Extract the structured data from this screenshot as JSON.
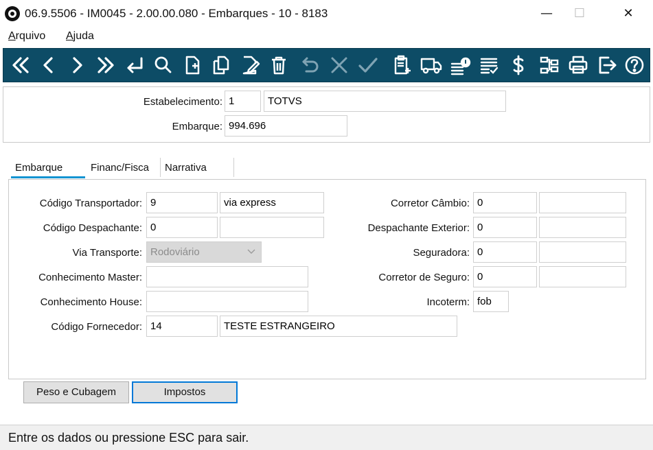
{
  "window": {
    "title": "06.9.5506 - IM0045 - 2.00.00.080 - Embarques - 10 - 8183",
    "minimize": "—",
    "maximize": "☐",
    "close": "✕"
  },
  "menu": {
    "items": [
      {
        "label": "Arquivo",
        "accel": "A"
      },
      {
        "label": "Ajuda",
        "accel": "A"
      }
    ]
  },
  "toolbar": {
    "buttons": [
      {
        "icon": "first-record-icon"
      },
      {
        "icon": "previous-record-icon"
      },
      {
        "icon": "next-record-icon"
      },
      {
        "icon": "last-record-icon"
      },
      {
        "icon": "goto-return-icon"
      },
      {
        "icon": "search-icon"
      },
      {
        "icon": "new-document-icon"
      },
      {
        "icon": "copy-icon"
      },
      {
        "icon": "edit-icon"
      },
      {
        "icon": "delete-icon"
      },
      {
        "icon": "undo-icon"
      },
      {
        "icon": "cancel-icon"
      },
      {
        "icon": "confirm-icon"
      },
      {
        "icon": "clipboard-add-icon"
      },
      {
        "icon": "truck-icon"
      },
      {
        "icon": "list-alert-icon"
      },
      {
        "icon": "checklist-icon"
      },
      {
        "icon": "dollar-icon"
      },
      {
        "icon": "hierarchy-icon"
      },
      {
        "icon": "print-icon"
      },
      {
        "icon": "exit-icon"
      },
      {
        "icon": "help-icon"
      }
    ]
  },
  "header": {
    "estabelecimento_label": "Estabelecimento:",
    "estabelecimento_code": "1",
    "estabelecimento_name": "TOTVS",
    "embarque_label": "Embarque:",
    "embarque_value": "994.696"
  },
  "tabs": [
    {
      "label": "Embarque",
      "active": true
    },
    {
      "label": "Financ/Fisca",
      "active": false
    },
    {
      "label": "Narrativa",
      "active": false
    }
  ],
  "form": {
    "codigo_transportador": {
      "label": "Código Transportador:",
      "code": "9",
      "desc": "via express"
    },
    "codigo_despachante": {
      "label": "Código Despachante:",
      "code": "0",
      "desc": ""
    },
    "via_transporte": {
      "label": "Via Transporte:",
      "value": "Rodoviário"
    },
    "conhecimento_master": {
      "label": "Conhecimento Master:",
      "value": ""
    },
    "conhecimento_house": {
      "label": "Conhecimento House:",
      "value": ""
    },
    "codigo_fornecedor": {
      "label": "Código Fornecedor:",
      "code": "14",
      "desc": "TESTE ESTRANGEIRO"
    },
    "corretor_cambio": {
      "label": "Corretor Câmbio:",
      "code": "0",
      "desc": ""
    },
    "despachante_exterior": {
      "label": "Despachante Exterior:",
      "code": "0",
      "desc": ""
    },
    "seguradora": {
      "label": "Seguradora:",
      "code": "0",
      "desc": ""
    },
    "corretor_seguro": {
      "label": "Corretor de Seguro:",
      "code": "0",
      "desc": ""
    },
    "incoterm": {
      "label": "Incoterm:",
      "value": "fob"
    }
  },
  "buttons": {
    "peso_cubagem": "Peso e Cubagem",
    "impostos": "Impostos"
  },
  "status": {
    "message": "Entre os dados ou pressione ESC para sair."
  },
  "colors": {
    "toolbar_bg": "#0d4c66",
    "tab_active_underline": "#1494d2",
    "focus_border": "#0078d7"
  }
}
